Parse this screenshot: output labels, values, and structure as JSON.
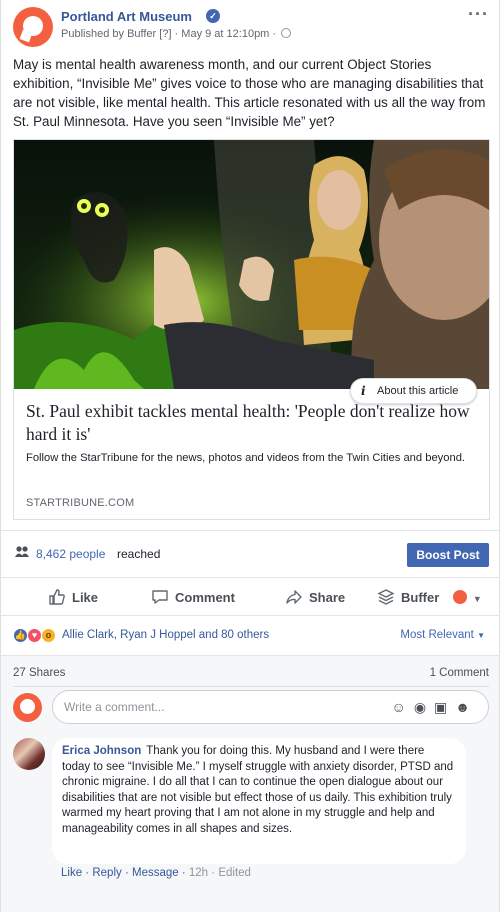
{
  "post": {
    "page_name": "Portland Art Museum",
    "published_prefix": "Published by",
    "published_app": "Buffer",
    "help_marker": "[?]",
    "date": "May 9 at 12:10pm",
    "caption": "May is mental health awareness month, and our current Object Stories exhibition, “Invisible Me” gives voice to those who are managing disabilities that are not visible, like mental health. This article resonated with us all the way from St. Paul Minnesota. Have you seen “Invisible Me” yet?"
  },
  "article": {
    "about_label": "About this article",
    "title": "St. Paul exhibit tackles mental health: 'People don't realize how hard it is'",
    "description": "Follow the StarTribune for the news, photos and videos from the Twin Cities and beyond.",
    "source": "STARTRIBUNE.COM"
  },
  "reach": {
    "count": "8,462 people",
    "suffix": "reached",
    "boost_label": "Boost Post"
  },
  "actions": {
    "like": "Like",
    "comment": "Comment",
    "share": "Share",
    "buffer": "Buffer"
  },
  "reactions": {
    "names": "Allie Clark, Ryan J Hoppel and 80 others",
    "sort_label": "Most Relevant"
  },
  "comments": {
    "shares": "27 Shares",
    "count": "1 Comment",
    "placeholder": "Write a comment...",
    "items": [
      {
        "author": "Erica Johnson",
        "text": "Thank you for doing this. My husband and I were there today to see “Invisible Me.” I myself struggle with anxiety disorder, PTSD and chronic migraine. I do all that I can to continue the open dialogue about our disabilities that are not visible but effect those of us daily. This exhibition truly warmed my heart proving that I am not alone in my struggle and help and manageability comes in all shapes and sizes.",
        "like": "Like",
        "reply": "Reply",
        "message": "Message",
        "time": "12h",
        "edited": "Edited"
      }
    ]
  },
  "colors": {
    "link_blue": "#365899",
    "button_blue": "#4267b2",
    "buffer_orange": "#f4603f"
  }
}
